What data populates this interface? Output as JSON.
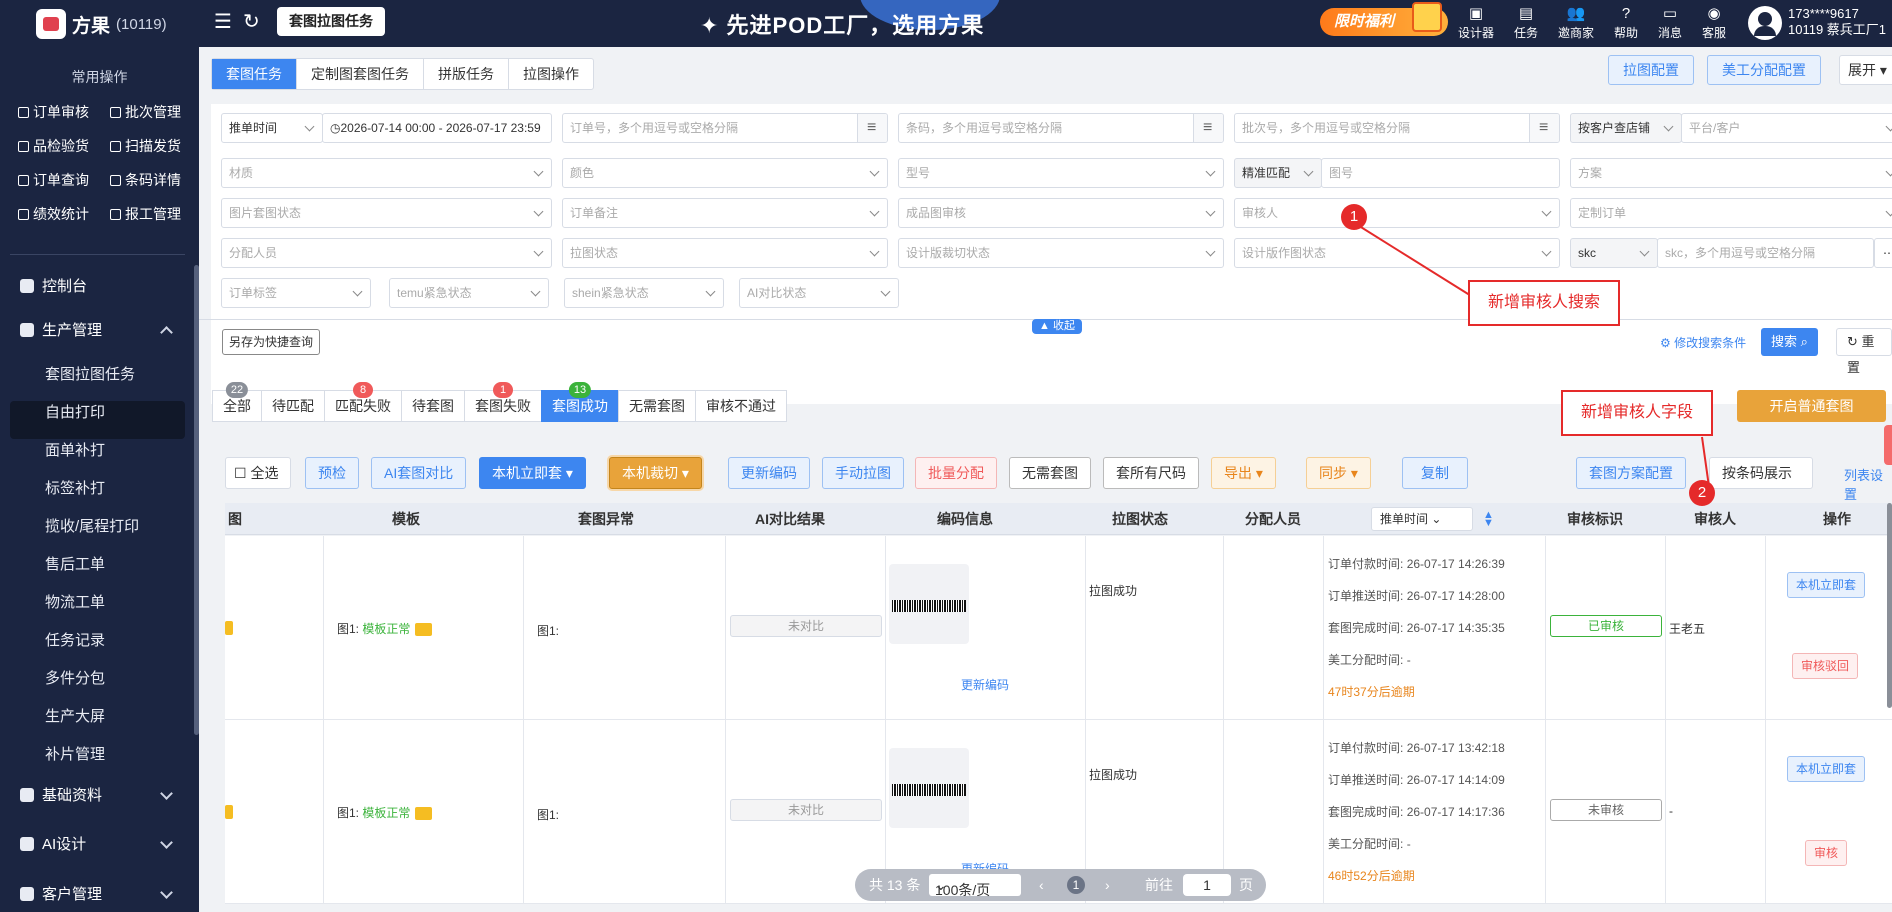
{
  "topbar": {
    "brand_name": "方果",
    "brand_id": "(10119)",
    "current_page": "套图拉图任务",
    "slogan": "先进POD工厂，选用方果",
    "promo": "限时福利",
    "menus": [
      "设计器",
      "任务",
      "邀商家",
      "帮助",
      "消息",
      "客服"
    ],
    "account_phone": "173****9617",
    "account_name": "10119 蔡兵工厂1"
  },
  "sidebar": {
    "quick_title": "常用操作",
    "quick": [
      "订单审核",
      "批次管理",
      "品检验货",
      "扫描发货",
      "订单查询",
      "条码详情",
      "绩效统计",
      "报工管理"
    ],
    "nav": {
      "dashboard": "控制台",
      "production": "生产管理",
      "basic": "基础资料",
      "ai": "AI设计",
      "customer": "客户管理"
    },
    "sub": [
      "套图拉图任务",
      "自由打印",
      "面单补打",
      "标签补打",
      "揽收/尾程打印",
      "售后工单",
      "物流工单",
      "任务记录",
      "多件分包",
      "生产大屏",
      "补片管理"
    ]
  },
  "tabs": [
    "套图任务",
    "定制图套图任务",
    "拼版任务",
    "拉图操作"
  ],
  "header_buttons": {
    "config": "拉图配置",
    "assign": "美工分配配置",
    "expand": "展开"
  },
  "filters": {
    "push_time": "推单时间",
    "date_range": "2026-07-14 00:00 - 2026-07-17 23:59",
    "order_no": "订单号，多个用逗号或空格分隔",
    "barcode": "条码，多个用逗号或空格分隔",
    "batch": "批次号，多个用逗号或空格分隔",
    "shop_mode": "按客户查店铺",
    "platform": "平台/客户",
    "material": "材质",
    "color": "颜色",
    "model": "型号",
    "match": "精准匹配",
    "pattern": "图号",
    "plan": "方案",
    "img_status": "图片套图状态",
    "order_note": "订单备注",
    "product_audit": "成品图审核",
    "auditor": "审核人",
    "custom_order": "定制订单",
    "assignee": "分配人员",
    "pull_status": "拉图状态",
    "crop_status": "设计版裁切状态",
    "make_status": "设计版作图状态",
    "skc": "skc",
    "skc_input": "skc，多个用逗号或空格分隔",
    "order_tag": "订单标签",
    "temu": "temu紧急状态",
    "shein": "shein紧急状态",
    "ai_status": "AI对比状态",
    "collapse": "收起",
    "save_quick": "另存为快捷查询",
    "modify": "修改搜索条件",
    "search": "搜索",
    "reset": "重置"
  },
  "status_tabs": [
    {
      "label": "全部",
      "badge": "22",
      "badge_color": "#8a8f98"
    },
    {
      "label": "待匹配",
      "badge": "",
      "badge_color": ""
    },
    {
      "label": "匹配失败",
      "badge": "8",
      "badge_color": "#f05a5a"
    },
    {
      "label": "待套图",
      "badge": "",
      "badge_color": ""
    },
    {
      "label": "套图失败",
      "badge": "1",
      "badge_color": "#f05a5a"
    },
    {
      "label": "套图成功",
      "badge": "13",
      "badge_color": "#3bb33b"
    },
    {
      "label": "无需套图",
      "badge": "",
      "badge_color": ""
    },
    {
      "label": "审核不通过",
      "badge": "",
      "badge_color": ""
    }
  ],
  "open_normal": "开启普通套图",
  "toolbar": {
    "select_all": "全选",
    "precheck": "预检",
    "ai_compare": "AI套图对比",
    "local_now": "本机立即套",
    "local_cut": "本机裁切",
    "update_code": "更新编码",
    "manual_pull": "手动拉图",
    "batch_assign": "批量分配",
    "no_need": "无需套图",
    "all_size": "套所有尺码",
    "export": "导出",
    "sync": "同步",
    "copy": "复制",
    "plan_config": "套图方案配置",
    "barcode_view": "按条码展示",
    "col_settings": "列表设置"
  },
  "table": {
    "headers": {
      "img": "图",
      "template": "模板",
      "abnormal": "套图异常",
      "ai_result": "AI对比结果",
      "code_info": "编码信息",
      "pull_status": "拉图状态",
      "assignee": "分配人员",
      "time_select": "推单时间",
      "audit_flag": "审核标识",
      "auditor": "审核人",
      "ops": "操作"
    },
    "time_labels": [
      "订单付款时间:",
      "订单推送时间:",
      "套图完成时间:",
      "美工分配时间:"
    ],
    "rows": [
      {
        "template_prefix": "图1:",
        "template_status": "模板正常",
        "abnormal": "图1:",
        "ai": "未对比",
        "update_code": "更新编码",
        "pull_status": "拉图成功",
        "times": [
          "26-07-17 14:26:39",
          "26-07-17 14:28:00",
          "26-07-17 14:35:35",
          "-"
        ],
        "overdue": "47时37分后逾期",
        "audit_flag": "已审核",
        "auditor": "王老五",
        "op1": "本机立即套",
        "op2": "审核驳回"
      },
      {
        "template_prefix": "图1:",
        "template_status": "模板正常",
        "abnormal": "图1:",
        "ai": "未对比",
        "update_code": "更新编码",
        "pull_status": "拉图成功",
        "times": [
          "26-07-17 13:42:18",
          "26-07-17 14:14:09",
          "26-07-17 14:17:36",
          "-"
        ],
        "overdue": "46时52分后逾期",
        "audit_flag": "未审核",
        "auditor": "-",
        "op1": "本机立即套",
        "op2": "审核"
      }
    ]
  },
  "annotations": {
    "a1_num": "1",
    "a1_text": "新增审核人搜索",
    "a2_num": "2",
    "a2_text": "新增审核人字段"
  },
  "pager": {
    "total": "共 13 条",
    "size": "100条/页",
    "page": "1",
    "goto": "前往",
    "goto_val": "1",
    "unit": "页"
  }
}
